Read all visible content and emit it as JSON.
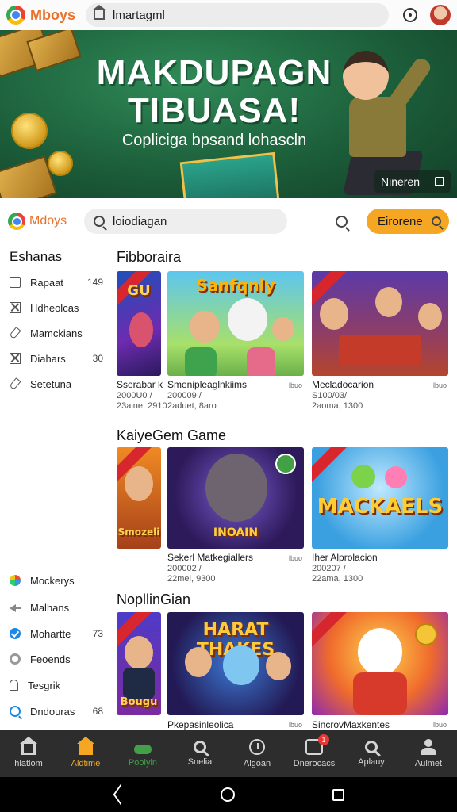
{
  "browser": {
    "brand": "Mboys",
    "url": "lmartagml",
    "icons": [
      "home-icon",
      "more-icon",
      "profile-avatar"
    ]
  },
  "hero": {
    "title_line1": "MAKDUPAGN",
    "title_line2": "TIBUASA!",
    "subtitle": "Copliciga bpsand lohascln",
    "badge": "Nineren"
  },
  "header": {
    "brand": "Mdoys",
    "search_value": "loiodiagan",
    "cta": "Eirorene"
  },
  "sidebar": {
    "title": "Eshanas",
    "items": [
      {
        "label": "Rapaat",
        "count": "149",
        "icon": "checkbox-icon"
      },
      {
        "label": "Hdheolcas",
        "count": "",
        "icon": "cross-box-icon"
      },
      {
        "label": "Mamckians",
        "count": "",
        "icon": "tag-icon"
      },
      {
        "label": "Diahars",
        "count": "30",
        "icon": "cross-box-icon"
      },
      {
        "label": "Setetuna",
        "count": "",
        "icon": "tag-icon"
      }
    ],
    "lower_items": [
      {
        "label": "Mockerys",
        "count": "",
        "icon": "grid-icon"
      },
      {
        "label": "Malhans",
        "count": "",
        "icon": "arrow-icon"
      },
      {
        "label": "Mohartte",
        "count": "73",
        "icon": "check-circle-icon"
      },
      {
        "label": "Feoends",
        "count": "",
        "icon": "ring-icon"
      },
      {
        "label": "Tesgrik",
        "count": "",
        "icon": "door-icon"
      },
      {
        "label": "Dndouras",
        "count": "68",
        "icon": "search-icon"
      }
    ]
  },
  "sections": [
    {
      "title": "Fibboraira",
      "cards": [
        {
          "art": "GU",
          "title": "Sserabar k",
          "meta1": "2000U0 /",
          "meta2": "23aine, 2910",
          "tag": ""
        },
        {
          "art": "Sanfqnly",
          "title": "Smenipleaglnkiims",
          "meta1": "200009 /",
          "meta2": "2aduet, 8aro",
          "tag": "lbuo"
        },
        {
          "art": "",
          "title": "Mecladocarion",
          "meta1": "S100/03/",
          "meta2": "2aoma, 1300",
          "tag": "lbuo"
        }
      ]
    },
    {
      "title": "KaiyeGem Game",
      "cards": [
        {
          "art": "Smozeli",
          "title": "",
          "meta1": "",
          "meta2": "",
          "tag": ""
        },
        {
          "art": "INOAIN",
          "title": "Sekerl Matkegiallers",
          "meta1": "200002 /",
          "meta2": "22mei, 9300",
          "tag": "lbuo"
        },
        {
          "art": "MACKAELS",
          "title": "Iher Alprolacion",
          "meta1": "200207 /",
          "meta2": "22ama, 1300",
          "tag": ""
        }
      ]
    },
    {
      "title": "NopllinGian",
      "cards": [
        {
          "art": "Bougu",
          "title": "",
          "meta1": "",
          "meta2": "",
          "tag": ""
        },
        {
          "art": "HARAT THAKES",
          "title": "Pkepasinleolica",
          "meta1": "",
          "meta2": "",
          "tag": "lbuo"
        },
        {
          "art": "",
          "title": "SincrovMaxkentes",
          "meta1": "",
          "meta2": "",
          "tag": "lbuo"
        }
      ]
    }
  ],
  "bottom_nav": [
    {
      "label": "hlatlom",
      "icon": "home-icon",
      "state": "default"
    },
    {
      "label": "Aldtime",
      "icon": "house-icon",
      "state": "active"
    },
    {
      "label": "Pooiyln",
      "icon": "gamepad-icon",
      "state": "green"
    },
    {
      "label": "Snelia",
      "icon": "search-icon",
      "state": "default"
    },
    {
      "label": "Algoan",
      "icon": "clock-icon",
      "state": "default"
    },
    {
      "label": "Dnerocacs",
      "icon": "chat-icon",
      "state": "default",
      "badge": "1"
    },
    {
      "label": "Aplauy",
      "icon": "search-icon",
      "state": "default"
    },
    {
      "label": "Aulmet",
      "icon": "user-icon",
      "state": "default"
    }
  ],
  "colors": {
    "accent": "#f5a623",
    "hero_green": "#1c5e3a",
    "nav_bg": "#2d2d2d",
    "brand_orange": "#e8712b"
  }
}
